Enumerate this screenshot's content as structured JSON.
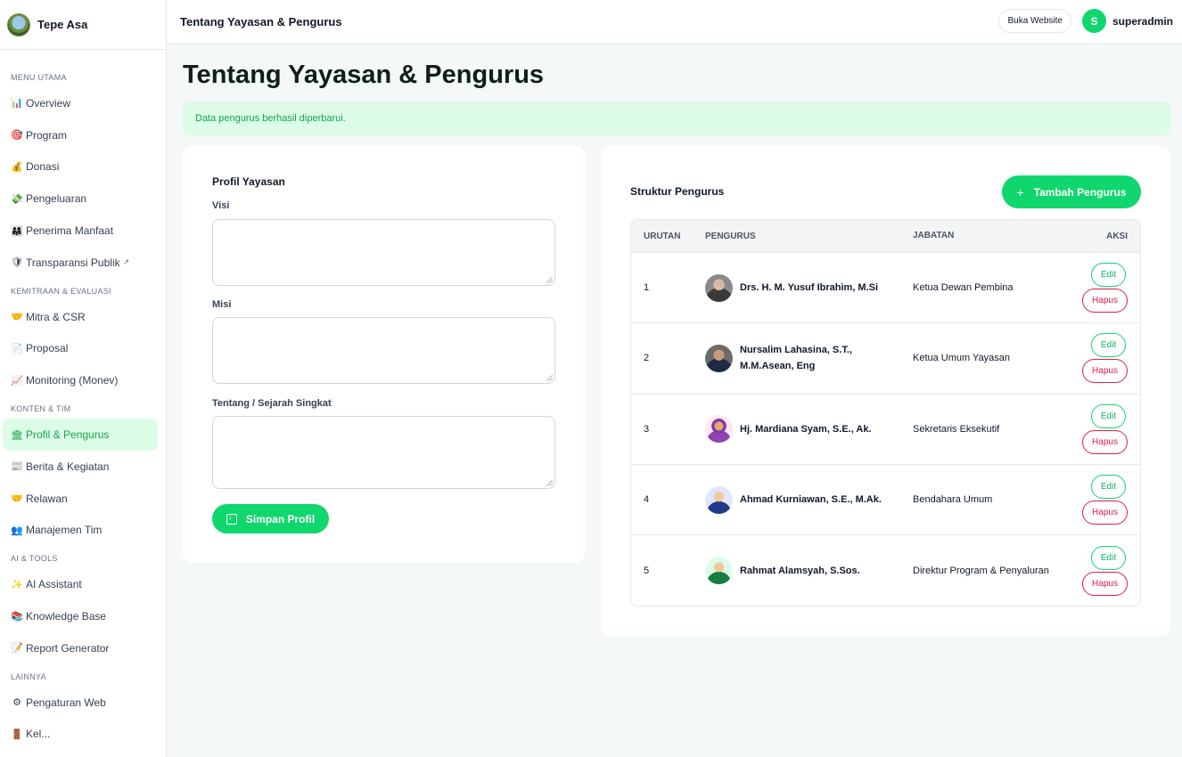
{
  "brand": {
    "name": "Tepe Asa"
  },
  "sidebar": {
    "groups": [
      {
        "label": "MENU UTAMA",
        "items": [
          {
            "icon": "📊",
            "label": "Overview"
          },
          {
            "icon": "🎯",
            "label": "Program"
          },
          {
            "icon": "💰",
            "label": "Donasi"
          },
          {
            "icon": "💸",
            "label": "Pengeluaran"
          },
          {
            "icon": "👨‍👩‍👧",
            "label": "Penerima Manfaat"
          },
          {
            "icon": "🛡",
            "label": "Transparansi Publik",
            "ext": "↗"
          }
        ]
      },
      {
        "label": "KEMITRAAN & EVALUASI",
        "items": [
          {
            "icon": "🤝",
            "label": "Mitra & CSR"
          },
          {
            "icon": "📄",
            "label": "Proposal"
          },
          {
            "icon": "📈",
            "label": "Monitoring (Monev)"
          }
        ]
      },
      {
        "label": "KONTEN & TIM",
        "items": [
          {
            "icon": "🏛",
            "label": "Profil & Pengurus",
            "active": true
          },
          {
            "icon": "📰",
            "label": "Berita & Kegiatan"
          },
          {
            "icon": "🤝",
            "label": "Relawan"
          },
          {
            "icon": "👥",
            "label": "Manajemen Tim"
          }
        ]
      },
      {
        "label": "AI & TOOLS",
        "items": [
          {
            "icon": "✨",
            "label": "AI Assistant"
          },
          {
            "icon": "📚",
            "label": "Knowledge Base"
          },
          {
            "icon": "📝",
            "label": "Report Generator"
          }
        ]
      },
      {
        "label": "LAINNYA",
        "items": [
          {
            "icon": "⚙",
            "label": "Pengaturan Web"
          },
          {
            "icon": "🚪",
            "label": "Kel..."
          }
        ]
      }
    ]
  },
  "header": {
    "title": "Tentang Yayasan & Pengurus",
    "website_button": "Buka Website",
    "avatar_initial": "S",
    "username": "superadmin"
  },
  "main": {
    "title": "Tentang Yayasan & Pengurus",
    "alert": "Data pengurus berhasil diperbarui.",
    "profile": {
      "title": "Profil Yayasan",
      "visi_label": "Visi",
      "misi_label": "Misi",
      "tentang_label": "Tentang / Sejarah Singkat",
      "save_button": "Simpan Profil"
    },
    "structure": {
      "title": "Struktur Pengurus",
      "add_button": "Tambah Pengurus",
      "columns": [
        "URUTAN",
        "PENGURUS",
        "JABATAN",
        "AKSI"
      ],
      "edit_label": "Edit",
      "delete_label": "Hapus",
      "rows": [
        {
          "order": "1",
          "name": "Drs. H. M. Yusuf Ibrahim, M.Si",
          "role": "Ketua Dewan Pembina",
          "photo": "p1"
        },
        {
          "order": "2",
          "name": "Nursalim Lahasina, S.T., M.M.Asean, Eng",
          "role": "Ketua Umum Yayasan",
          "photo": "p2"
        },
        {
          "order": "3",
          "name": "Hj. Mardiana Syam, S.E., Ak.",
          "role": "Sekretaris Eksekutif",
          "photo": "p3"
        },
        {
          "order": "4",
          "name": "Ahmad Kurniawan, S.E., M.Ak.",
          "role": "Bendahara Umum",
          "photo": "p4"
        },
        {
          "order": "5",
          "name": "Rahmat Alamsyah, S.Sos.",
          "role": "Direktur Program & Penyaluran",
          "photo": "p5"
        }
      ]
    }
  }
}
